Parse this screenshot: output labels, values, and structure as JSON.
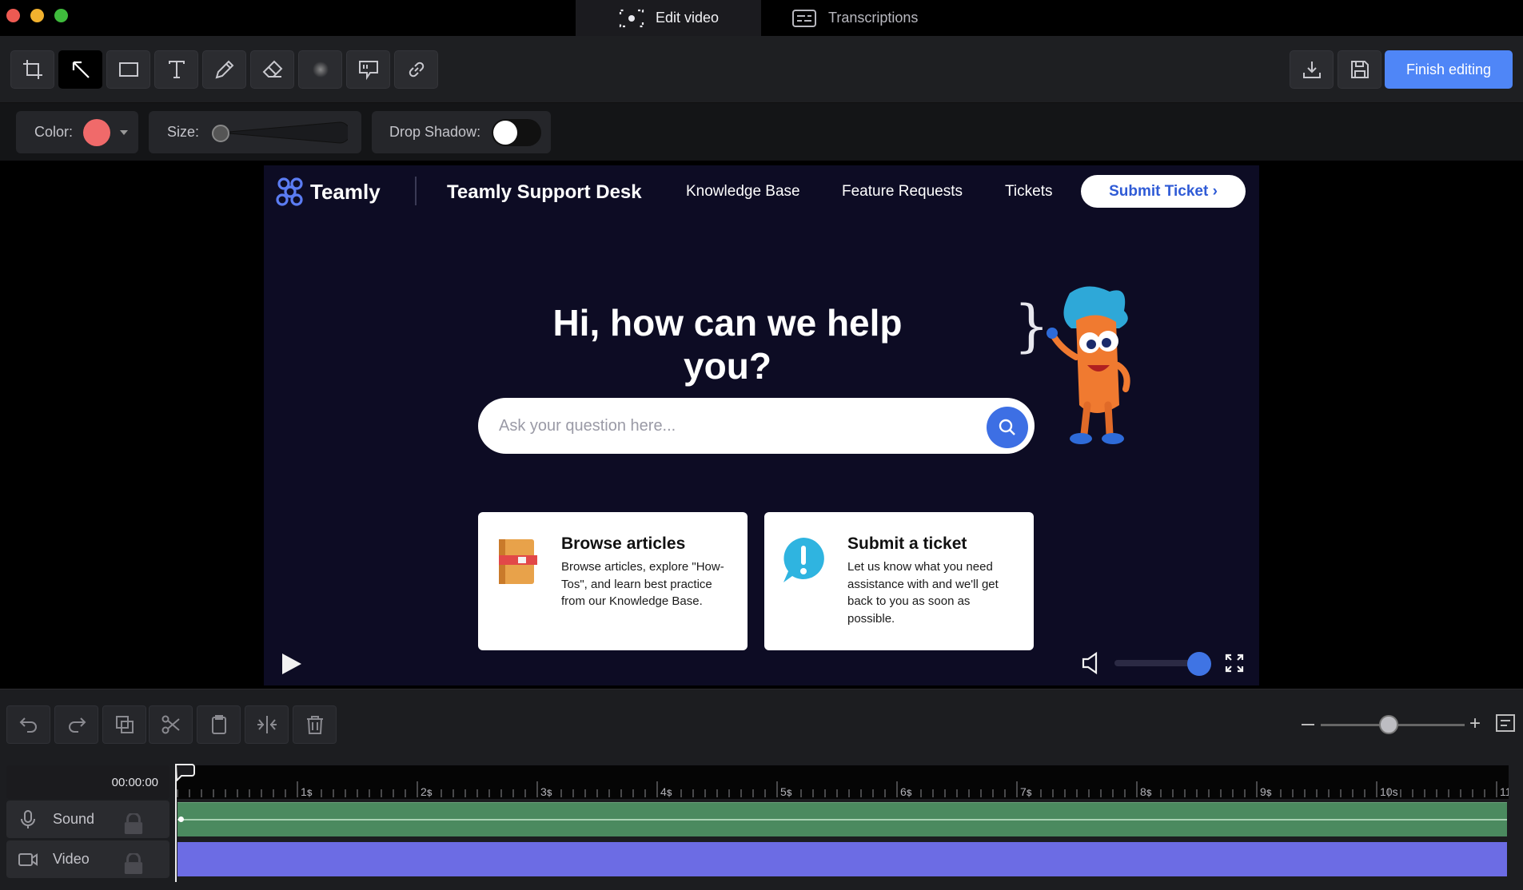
{
  "window": {
    "tabs": [
      {
        "label": "Edit video",
        "active": true
      },
      {
        "label": "Transcriptions",
        "active": false
      }
    ]
  },
  "toolbar": {
    "tools": [
      "crop-icon",
      "arrow-icon",
      "rectangle-icon",
      "text-icon",
      "pen-icon",
      "eraser-icon",
      "blur-icon",
      "callout-icon",
      "link-icon"
    ],
    "active_tool": "arrow-icon",
    "finish_label": "Finish editing"
  },
  "properties": {
    "color_label": "Color:",
    "color_value": "#f06a6a",
    "size_label": "Size:",
    "size_value": 0,
    "shadow_label": "Drop Shadow:",
    "shadow_enabled": false
  },
  "video": {
    "brand": "Teamly",
    "nav_title": "Teamly Support Desk",
    "nav_links": [
      "Knowledge Base",
      "Feature Requests",
      "Tickets"
    ],
    "cta": "Submit Ticket ›",
    "hero": "Hi, how can we help you?",
    "search_placeholder": "Ask your question here...",
    "cards": [
      {
        "title": "Browse articles",
        "text": "Browse articles, explore \"How-Tos\", and learn best practice from our Knowledge Base."
      },
      {
        "title": "Submit a ticket",
        "text": "Let us know what you need assistance with and we'll get back to you as soon as possible."
      }
    ],
    "volume_level": 1.0,
    "annotation_color": "#4a7fe8"
  },
  "edit_tools": [
    "undo-icon",
    "redo-icon",
    "copy-icon",
    "scissors-icon",
    "clipboard-icon",
    "split-icon",
    "trash-icon"
  ],
  "zoom_level": 0.5,
  "timeline": {
    "timecode": "00:00:00",
    "tracks": [
      {
        "label": "Sound",
        "color": "#4b8a5f"
      },
      {
        "label": "Video",
        "color": "#6c6ce4"
      }
    ],
    "ruler_labels": [
      "1s",
      "2s",
      "3s",
      "4s",
      "5s",
      "6s",
      "7s",
      "8s",
      "9s",
      "10s",
      "11"
    ]
  }
}
